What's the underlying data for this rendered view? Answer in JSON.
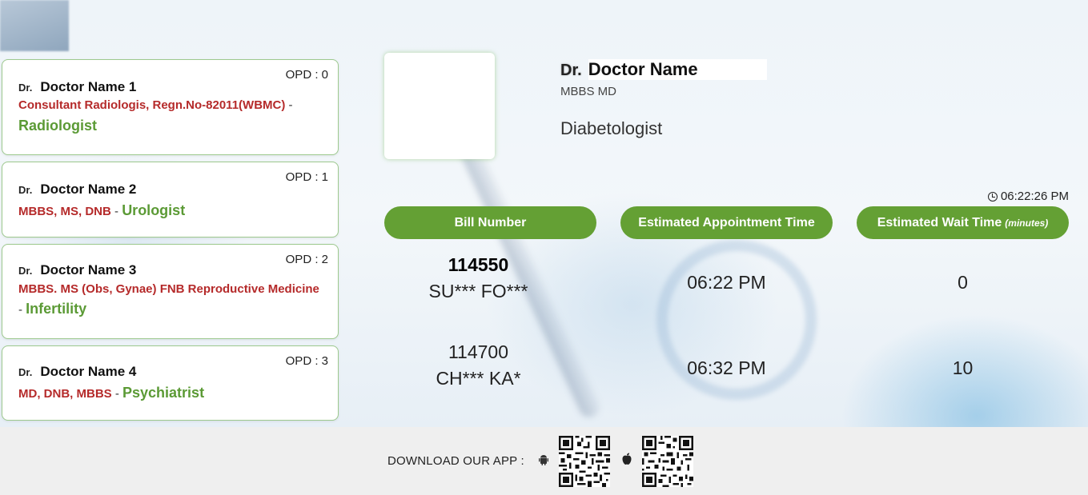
{
  "doctors": [
    {
      "dr": "Dr.",
      "name": "Doctor Name 1",
      "opd": "OPD : 0",
      "qualification": "Consultant Radiologis, Regn.No-82011(WBMC)",
      "separator": " - ",
      "specialty": "Radiologist"
    },
    {
      "dr": "Dr.",
      "name": "Doctor Name 2",
      "opd": "OPD : 1",
      "qualification": "MBBS, MS, DNB",
      "separator": " - ",
      "specialty": "Urologist"
    },
    {
      "dr": "Dr.",
      "name": "Doctor Name 3",
      "opd": "OPD : 2",
      "qualification": "MBBS. MS (Obs, Gynae) FNB Reproductive Medicine",
      "separator": "- ",
      "specialty": "Infertility"
    },
    {
      "dr": "Dr.",
      "name": "Doctor Name 4",
      "opd": "OPD : 3",
      "qualification": "MD, DNB, MBBS",
      "separator": " - ",
      "specialty": "Psychiatrist"
    }
  ],
  "current_doctor": {
    "dr": "Dr.",
    "name": "Doctor Name",
    "qualification": "MBBS MD",
    "specialty": "Diabetologist"
  },
  "clock": {
    "time": "06:22:26 PM",
    "icon": "clock-icon"
  },
  "table": {
    "headers": {
      "bill_number": "Bill Number",
      "appointment_time": "Estimated Appointment Time",
      "wait_time": "Estimated Wait Time",
      "wait_unit": "(minutes)"
    },
    "rows": [
      {
        "bill": "114550",
        "patient": "SU*** FO***",
        "time": "06:22 PM",
        "wait": "0"
      },
      {
        "bill": "114700",
        "patient": "CH*** KA*",
        "time": "06:32 PM",
        "wait": "10"
      }
    ]
  },
  "footer": {
    "label": "DOWNLOAD OUR APP :",
    "android_icon": "android-icon",
    "apple_icon": "apple-icon"
  },
  "colors": {
    "accent_green": "#64a034",
    "specialty_green": "#5b9a35",
    "qualification_red": "#b52a2a",
    "card_border": "#9dc98e"
  }
}
